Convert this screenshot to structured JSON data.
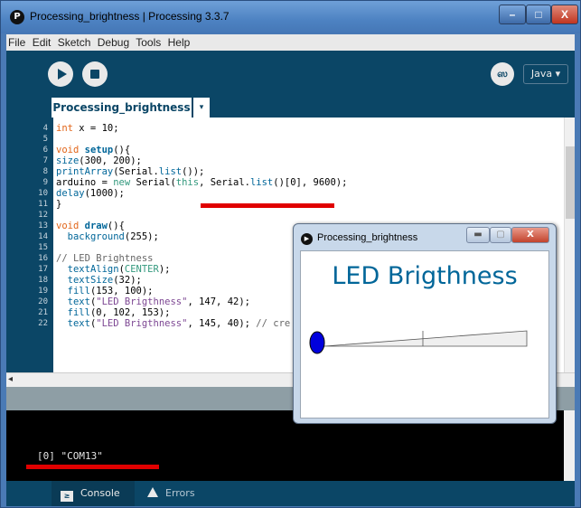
{
  "window": {
    "title": "Processing_brightness | Processing 3.3.7",
    "app_icon_glyph": "P",
    "min_glyph": "–",
    "max_glyph": "□",
    "close_glyph": "X"
  },
  "menu": {
    "items": [
      "File",
      "Edit",
      "Sketch",
      "Debug",
      "Tools",
      "Help"
    ]
  },
  "toolbar": {
    "run_icon": "play-icon",
    "stop_icon": "stop-icon",
    "debug_icon": "butterfly-icon",
    "debug_glyph": "ஸ",
    "mode_label": "Java ▾"
  },
  "tabs": {
    "active_label": "Processing_brightness",
    "menu_glyph": "▾"
  },
  "editor": {
    "lines": [
      {
        "n": "4",
        "code": [
          {
            "t": "int",
            "c": "kw"
          },
          {
            "t": " x = 10;",
            "c": ""
          }
        ]
      },
      {
        "n": "5",
        "code": []
      },
      {
        "n": "6",
        "code": [
          {
            "t": "void",
            "c": "kw"
          },
          {
            "t": " ",
            "c": ""
          },
          {
            "t": "setup",
            "c": "fn bold"
          },
          {
            "t": "(){",
            "c": ""
          }
        ]
      },
      {
        "n": "7",
        "code": [
          {
            "t": "size",
            "c": "fn"
          },
          {
            "t": "(300, 200);",
            "c": ""
          }
        ]
      },
      {
        "n": "8",
        "code": [
          {
            "t": "printArray",
            "c": "fn"
          },
          {
            "t": "(Serial.",
            "c": ""
          },
          {
            "t": "list",
            "c": "fn"
          },
          {
            "t": "());",
            "c": ""
          }
        ]
      },
      {
        "n": "9",
        "code": [
          {
            "t": "arduino = ",
            "c": ""
          },
          {
            "t": "new",
            "c": "kw2"
          },
          {
            "t": " Serial(",
            "c": ""
          },
          {
            "t": "this",
            "c": "kw2"
          },
          {
            "t": ", Serial.",
            "c": ""
          },
          {
            "t": "list",
            "c": "fn"
          },
          {
            "t": "()[0], 9600);",
            "c": ""
          }
        ]
      },
      {
        "n": "10",
        "code": [
          {
            "t": "delay",
            "c": "fn"
          },
          {
            "t": "(1000);",
            "c": ""
          }
        ]
      },
      {
        "n": "11",
        "code": [
          {
            "t": "}",
            "c": ""
          }
        ]
      },
      {
        "n": "12",
        "code": []
      },
      {
        "n": "13",
        "code": [
          {
            "t": "void",
            "c": "kw"
          },
          {
            "t": " ",
            "c": ""
          },
          {
            "t": "draw",
            "c": "fn bold"
          },
          {
            "t": "(){",
            "c": ""
          }
        ]
      },
      {
        "n": "14",
        "code": [
          {
            "t": "  ",
            "c": ""
          },
          {
            "t": "background",
            "c": "fn"
          },
          {
            "t": "(255);",
            "c": ""
          }
        ]
      },
      {
        "n": "15",
        "code": []
      },
      {
        "n": "16",
        "code": [
          {
            "t": "// LED Brightness",
            "c": "cm"
          }
        ]
      },
      {
        "n": "17",
        "code": [
          {
            "t": "  ",
            "c": ""
          },
          {
            "t": "textAlign",
            "c": "fn"
          },
          {
            "t": "(",
            "c": ""
          },
          {
            "t": "CENTER",
            "c": "kw2"
          },
          {
            "t": ");",
            "c": ""
          }
        ]
      },
      {
        "n": "18",
        "code": [
          {
            "t": "  ",
            "c": ""
          },
          {
            "t": "textSize",
            "c": "fn"
          },
          {
            "t": "(32);",
            "c": ""
          }
        ]
      },
      {
        "n": "19",
        "code": [
          {
            "t": "  ",
            "c": ""
          },
          {
            "t": "fill",
            "c": "fn"
          },
          {
            "t": "(153, 100);",
            "c": ""
          }
        ]
      },
      {
        "n": "20",
        "code": [
          {
            "t": "  ",
            "c": ""
          },
          {
            "t": "text",
            "c": "fn"
          },
          {
            "t": "(",
            "c": ""
          },
          {
            "t": "\"LED Brigthness\"",
            "c": "str"
          },
          {
            "t": ", 147, 42);",
            "c": ""
          }
        ]
      },
      {
        "n": "21",
        "code": [
          {
            "t": "  ",
            "c": ""
          },
          {
            "t": "fill",
            "c": "fn"
          },
          {
            "t": "(0, 102, 153);",
            "c": ""
          }
        ]
      },
      {
        "n": "22",
        "code": [
          {
            "t": "  ",
            "c": ""
          },
          {
            "t": "text",
            "c": "fn"
          },
          {
            "t": "(",
            "c": ""
          },
          {
            "t": "\"LED Brigthness\"",
            "c": "str"
          },
          {
            "t": ", 145, 40); ",
            "c": ""
          },
          {
            "t": "// cre",
            "c": "cm"
          }
        ]
      }
    ]
  },
  "console": {
    "output": "[0] \"COM13\""
  },
  "bottom_tabs": {
    "console_label": "Console",
    "console_glyph": "≥",
    "errors_label": "Errors"
  },
  "sketch_window": {
    "title": "Processing_brightness",
    "heading": "LED Brigthness",
    "slider_value_fraction": 0.0,
    "close_glyph": "X",
    "accent_color": "#006699",
    "knob_color": "#0000dd"
  },
  "colors": {
    "editor_bg": "#0b4666",
    "underline": "#e00000"
  }
}
